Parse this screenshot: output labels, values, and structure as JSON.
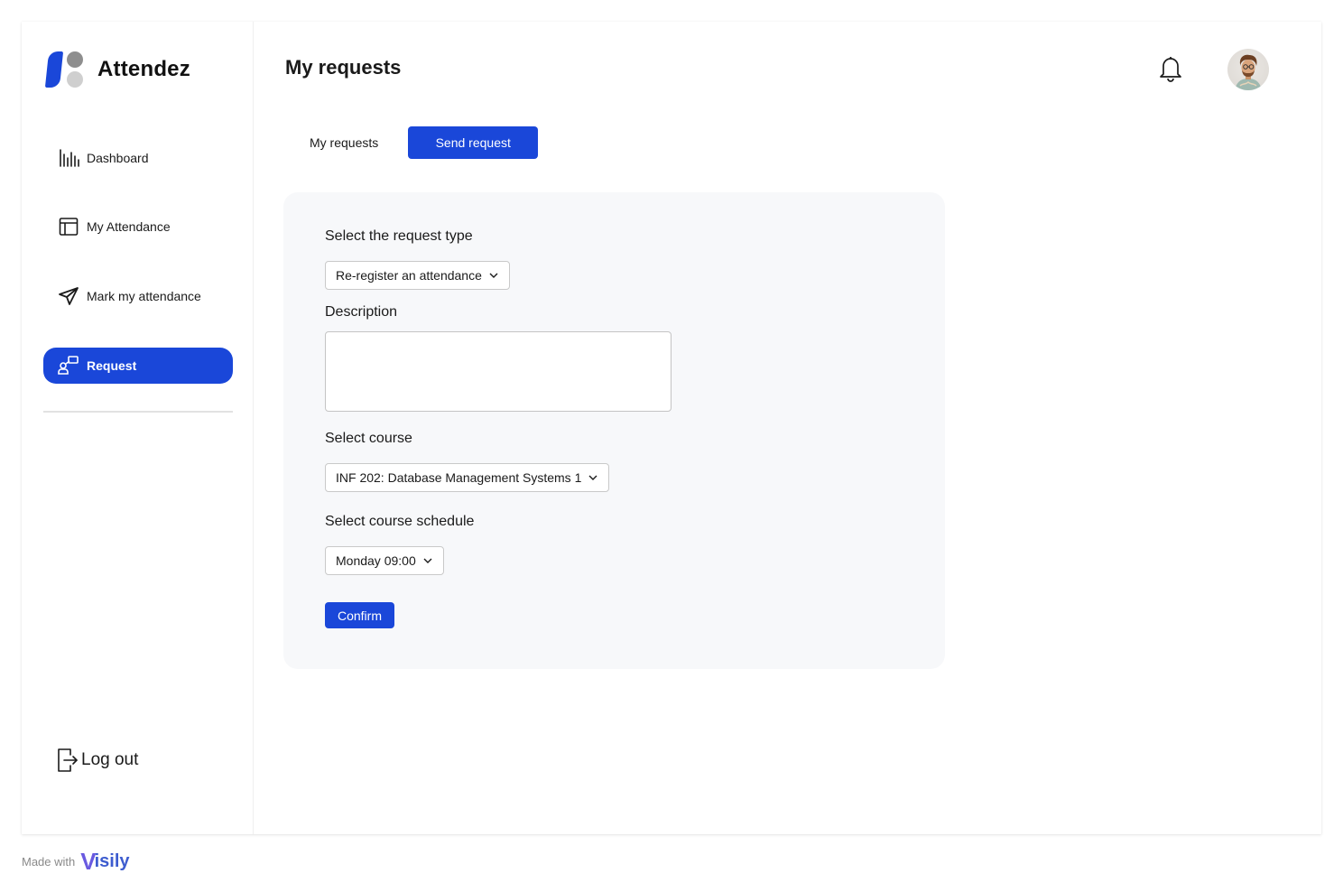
{
  "app": {
    "name": "Attendez"
  },
  "sidebar": {
    "items": [
      {
        "label": "Dashboard",
        "icon": "bar-chart-icon"
      },
      {
        "label": "My Attendance",
        "icon": "table-layout-icon"
      },
      {
        "label": "Mark my attendance",
        "icon": "send-icon"
      },
      {
        "label": "Request",
        "icon": "request-shapes-icon",
        "active": true
      }
    ],
    "logout_label": "Log out"
  },
  "header": {
    "title": "My requests",
    "icons": [
      "bell-icon",
      "avatar"
    ]
  },
  "tabs": [
    {
      "label": "My requests",
      "active": false
    },
    {
      "label": "Send request",
      "active": true
    }
  ],
  "form": {
    "request_type_label": "Select the request type",
    "request_type_value": "Re-register an attendance",
    "description_label": "Description",
    "description_value": "",
    "course_label": "Select course",
    "course_value": "INF 202: Database Management Systems 1",
    "schedule_label": "Select course schedule",
    "schedule_value": "Monday 09:00",
    "confirm_label": "Confirm"
  },
  "footer": {
    "made_with": "Made with",
    "brand_v": "V",
    "brand_rest": "isily"
  },
  "colors": {
    "accent": "#1a47d9",
    "card_bg": "#f7f8fa",
    "text": "#1a1a1a"
  }
}
